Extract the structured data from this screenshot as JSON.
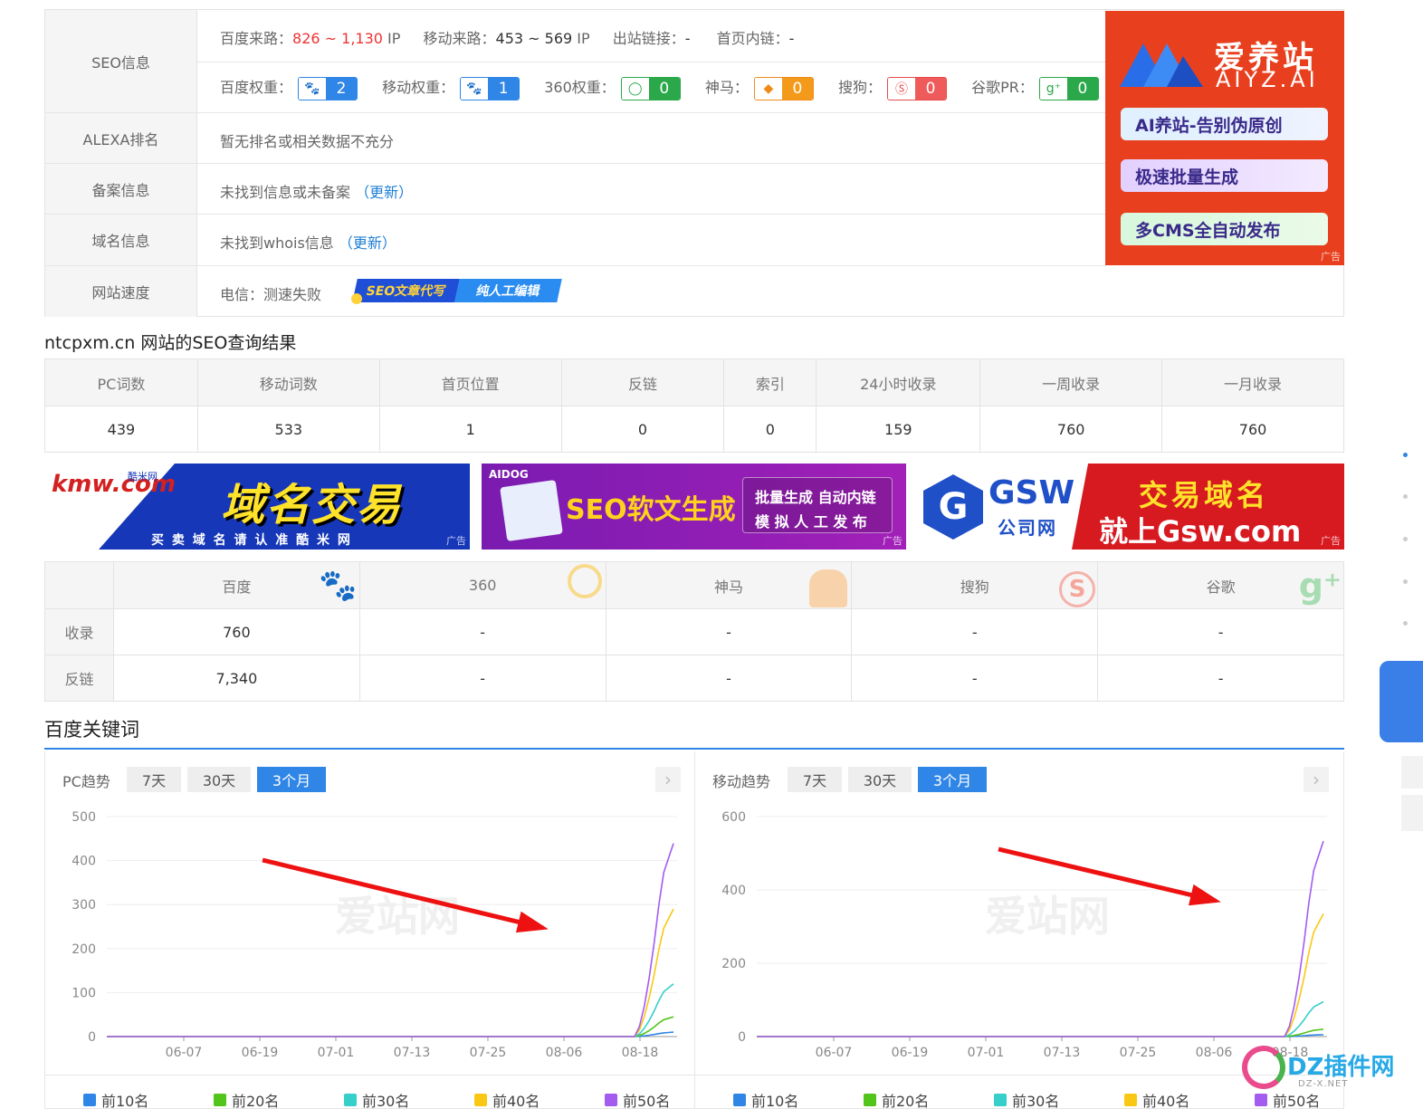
{
  "seo_info": {
    "label": "SEO信息",
    "baidu_traffic_label": "百度来路：",
    "baidu_traffic_value": "826 ~ 1,130",
    "baidu_traffic_unit": "IP",
    "mobile_traffic_label": "移动来路：",
    "mobile_traffic_value": "453 ~ 569",
    "mobile_traffic_unit": "IP",
    "outlinks_label": "出站链接：",
    "outlinks_value": "-",
    "home_inlinks_label": "首页内链：",
    "home_inlinks_value": "-",
    "weights": [
      {
        "label": "百度权重：",
        "value": "2",
        "icon": "paw-icon",
        "color": "blue"
      },
      {
        "label": "移动权重：",
        "value": "1",
        "icon": "paw-icon",
        "color": "blue"
      },
      {
        "label": "360权重：",
        "value": "0",
        "icon": "360-icon",
        "color": "green"
      },
      {
        "label": "神马：",
        "value": "0",
        "icon": "shenma-icon",
        "color": "orange"
      },
      {
        "label": "搜狗：",
        "value": "0",
        "icon": "sogou-icon",
        "color": "red"
      },
      {
        "label": "谷歌PR：",
        "value": "0",
        "icon": "google-plus-icon",
        "color": "green"
      }
    ]
  },
  "alexa": {
    "label": "ALEXA排名",
    "value": "暂无排名或相关数据不充分"
  },
  "beian": {
    "label": "备案信息",
    "value": "未找到信息或未备案",
    "update": "（更新）"
  },
  "whois": {
    "label": "域名信息",
    "value": "未找到whois信息",
    "update": "（更新）"
  },
  "speed": {
    "label": "网站速度",
    "value": "电信：测速失败",
    "ad_left": "SEO文章代写",
    "ad_right": "纯人工编辑"
  },
  "aiyz_ad": {
    "brand_cn": "爱养站",
    "brand_en": "AIYZ.AI",
    "buttons": [
      "AI养站-告别伪原创",
      "极速批量生成",
      "多CMS全自动发布"
    ],
    "tag": "广告"
  },
  "results": {
    "title": "ntcpxm.cn 网站的SEO查询结果",
    "headers": [
      "PC词数",
      "移动词数",
      "首页位置",
      "反链",
      "索引",
      "24小时收录",
      "一周收录",
      "一月收录"
    ],
    "values": [
      "439",
      "533",
      "1",
      "0",
      "0",
      "159",
      "760",
      "760"
    ]
  },
  "banners": [
    {
      "brand": "kmw.com",
      "brand_cn": "酷米网",
      "title": "域名交易",
      "sub": "买 卖 域 名 请 认 准 酷 米 网",
      "tag": "广告"
    },
    {
      "brand": "AIDOG",
      "title": "SEO软文生成",
      "sub1": "批量生成 自动内链",
      "sub2": "模 拟 人 工 发 布",
      "tag": "广告"
    },
    {
      "brand": "GSW",
      "brand_cn": "公司网",
      "title": "交易域名",
      "sub": "就上Gsw.com",
      "tag": "广告"
    }
  ],
  "engines": {
    "headers": [
      "百度",
      "360",
      "神马",
      "搜狗",
      "谷歌"
    ],
    "rows": [
      {
        "label": "收录",
        "values": [
          "760",
          "-",
          "-",
          "-",
          "-"
        ]
      },
      {
        "label": "反链",
        "values": [
          "7,340",
          "-",
          "-",
          "-",
          "-"
        ]
      }
    ]
  },
  "keywords": {
    "title": "百度关键词",
    "pc": {
      "label": "PC趋势",
      "tabs": [
        "7天",
        "30天",
        "3个月"
      ],
      "active_tab": "3个月"
    },
    "mobile": {
      "label": "移动趋势",
      "tabs": [
        "7天",
        "30天",
        "3个月"
      ],
      "active_tab": "3个月"
    },
    "legend": [
      "前10名",
      "前20名",
      "前30名",
      "前40名",
      "前50名"
    ],
    "watermark": "爱站网"
  },
  "chart_data": [
    {
      "type": "line",
      "x": [
        "06-07",
        "06-19",
        "07-01",
        "07-13",
        "07-25",
        "08-06",
        "08-18"
      ],
      "ylim": [
        0,
        500
      ],
      "yticks": [
        0,
        100,
        200,
        300,
        400,
        500
      ],
      "series": [
        {
          "name": "前10名",
          "color": "#2f86e6",
          "end": 10
        },
        {
          "name": "前20名",
          "color": "#52c41a",
          "end": 45
        },
        {
          "name": "前30名",
          "color": "#36cfc9",
          "end": 120
        },
        {
          "name": "前40名",
          "color": "#fac814",
          "end": 290
        },
        {
          "name": "前50名",
          "color": "#a35bf0",
          "end": 439
        }
      ]
    },
    {
      "type": "line",
      "x": [
        "06-07",
        "06-19",
        "07-01",
        "07-13",
        "07-25",
        "08-06",
        "08-18"
      ],
      "ylim": [
        0,
        600
      ],
      "yticks": [
        0,
        200,
        400,
        600
      ],
      "series": [
        {
          "name": "前10名",
          "color": "#2f86e6",
          "end": 5
        },
        {
          "name": "前20名",
          "color": "#52c41a",
          "end": 20
        },
        {
          "name": "前30名",
          "color": "#36cfc9",
          "end": 95
        },
        {
          "name": "前40名",
          "color": "#fac814",
          "end": 335
        },
        {
          "name": "前50名",
          "color": "#a35bf0",
          "end": 533
        }
      ]
    }
  ],
  "corner_brand": {
    "name": "DZ插件网",
    "sub": "DZ-X.NET"
  }
}
